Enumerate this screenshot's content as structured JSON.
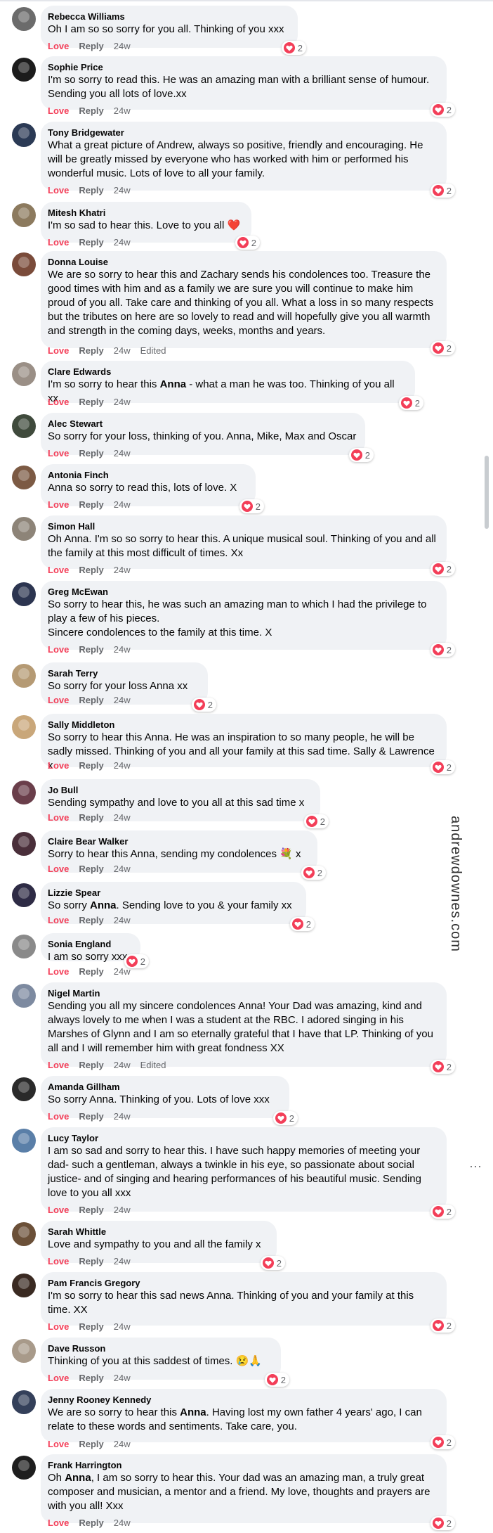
{
  "watermark": "andrewdownes.com",
  "more_menu": "···",
  "comments": [
    {
      "author": "Rebecca Williams",
      "text": "Oh I am so so sorry for you all. Thinking of you xxx",
      "love": "Love",
      "reply": "Reply",
      "time": "24w",
      "edited": "",
      "count": "2",
      "avatar_color": "#6b6b6b"
    },
    {
      "author": "Sophie Price",
      "text": "I'm so sorry to read this. He was an amazing man with a brilliant sense of humour. Sending you all lots of love.xx",
      "love": "Love",
      "reply": "Reply",
      "time": "24w",
      "edited": "",
      "count": "2",
      "avatar_color": "#1c1c1c"
    },
    {
      "author": "Tony Bridgewater",
      "text": "What a great picture of Andrew, always so positive, friendly and encouraging. He will be greatly missed by everyone who has worked with him or performed his wonderful music. Lots of love to all your family.",
      "love": "Love",
      "reply": "Reply",
      "time": "24w",
      "edited": "",
      "count": "2",
      "avatar_color": "#2b3a55"
    },
    {
      "author": "Mitesh Khatri",
      "text": "I'm so sad to hear this. Love to you all ❤️",
      "love": "Love",
      "reply": "Reply",
      "time": "24w",
      "edited": "",
      "count": "2",
      "avatar_color": "#8c7a5e"
    },
    {
      "author": "Donna Louise",
      "text": "We are so sorry to hear this and Zachary sends his condolences too. Treasure the good times with him and as a family we are sure you will continue to make him proud of you all. Take care and thinking of you all. What a loss in so many respects but the tributes on here are so lovely to read and will hopefully give you all warmth and strength in the coming days, weeks, months and years.",
      "love": "Love",
      "reply": "Reply",
      "time": "24w",
      "edited": "Edited",
      "count": "2",
      "avatar_color": "#7a4b3a"
    },
    {
      "author": "Clare Edwards",
      "text_pre": "I'm so sorry to hear this ",
      "text_bold": "Anna",
      "text_post": " - what a man he was too. Thinking of you all xx",
      "love": "Love",
      "reply": "Reply",
      "time": "24w",
      "edited": "",
      "count": "2",
      "avatar_color": "#9a8f86"
    },
    {
      "author": "Alec Stewart",
      "text": "So sorry for your loss, thinking of you. Anna, Mike, Max and Oscar",
      "love": "Love",
      "reply": "Reply",
      "time": "24w",
      "edited": "",
      "count": "2",
      "avatar_color": "#3f4a3c"
    },
    {
      "author": "Antonia Finch",
      "text": "Anna so sorry to read this, lots of love. X",
      "love": "Love",
      "reply": "Reply",
      "time": "24w",
      "edited": "",
      "count": "2",
      "avatar_color": "#7c5a44"
    },
    {
      "author": "Simon Hall",
      "text": "Oh Anna. I'm so so sorry to hear this. A unique musical soul. Thinking of you and all the family at this most difficult of times. Xx",
      "love": "Love",
      "reply": "Reply",
      "time": "24w",
      "edited": "",
      "count": "2",
      "avatar_color": "#8d8478"
    },
    {
      "author": "Greg McEwan",
      "text": "So sorry to hear this, he was such an amazing man to which I had the privilege to play a few of his pieces.\nSincere condolences to the family at this time. X",
      "love": "Love",
      "reply": "Reply",
      "time": "24w",
      "edited": "",
      "count": "2",
      "avatar_color": "#2c3550"
    },
    {
      "author": "Sarah Terry",
      "text": "So sorry for your loss Anna xx",
      "love": "Love",
      "reply": "Reply",
      "time": "24w",
      "edited": "",
      "count": "2",
      "avatar_color": "#b59a74"
    },
    {
      "author": "Sally Middleton",
      "text": "So sorry to hear this Anna. He was an inspiration to so many people, he will be sadly missed. Thinking of you and all your family at this sad time. Sally & Lawrence x",
      "love": "Love",
      "reply": "Reply",
      "time": "24w",
      "edited": "",
      "count": "2",
      "avatar_color": "#c9a77a"
    },
    {
      "author": "Jo Bull",
      "text": "Sending sympathy and love to you all at this sad time x",
      "love": "Love",
      "reply": "Reply",
      "time": "24w",
      "edited": "",
      "count": "2",
      "avatar_color": "#6a3e4a"
    },
    {
      "author": "Claire Bear Walker",
      "text": "Sorry to hear this Anna, sending my condolences 💐 x",
      "love": "Love",
      "reply": "Reply",
      "time": "24w",
      "edited": "",
      "count": "2",
      "avatar_color": "#4a2f3a"
    },
    {
      "author": "Lizzie Spear",
      "text_pre": "So sorry ",
      "text_bold": "Anna",
      "text_post": ". Sending love to you & your family xx",
      "love": "Love",
      "reply": "Reply",
      "time": "24w",
      "edited": "",
      "count": "2",
      "avatar_color": "#2e2b45"
    },
    {
      "author": "Sonia England",
      "text": "I am so sorry xxx",
      "love": "Love",
      "reply": "Reply",
      "time": "24w",
      "edited": "",
      "count": "2",
      "avatar_color": "#8a8a8a"
    },
    {
      "author": "Nigel Martin",
      "text": "Sending you all my sincere condolences Anna! Your Dad was amazing, kind and always lovely to me when I was a student at the RBC. I adored singing in his Marshes of Glynn and I am so eternally grateful that I have that LP. Thinking of you all and I will remember him with great fondness XX",
      "love": "Love",
      "reply": "Reply",
      "time": "24w",
      "edited": "Edited",
      "count": "2",
      "avatar_color": "#7d8aa0"
    },
    {
      "author": "Amanda Gillham",
      "text": "So sorry Anna. Thinking of you. Lots of love xxx",
      "love": "Love",
      "reply": "Reply",
      "time": "24w",
      "edited": "",
      "count": "2",
      "avatar_color": "#2a2a2a"
    },
    {
      "author": "Lucy Taylor",
      "text": "I am so sad and sorry to hear this. I have such happy memories of meeting your dad- such a gentleman, always a twinkle in his eye, so passionate about social justice- and of singing and hearing performances of his beautiful music. Sending love to you all xxx",
      "love": "Love",
      "reply": "Reply",
      "time": "24w",
      "edited": "",
      "count": "2",
      "avatar_color": "#5a7fa8"
    },
    {
      "author": "Sarah Whittle",
      "text": "Love and sympathy to you and all the family x",
      "love": "Love",
      "reply": "Reply",
      "time": "24w",
      "edited": "",
      "count": "2",
      "avatar_color": "#6b5038"
    },
    {
      "author": "Pam Francis Gregory",
      "text": "I'm so sorry to hear this sad news Anna. Thinking of you and your family at this time. XX",
      "love": "Love",
      "reply": "Reply",
      "time": "24w",
      "edited": "",
      "count": "2",
      "avatar_color": "#3a2a22"
    },
    {
      "author": "Dave Russon",
      "text": "Thinking of you at this saddest of times. 😢🙏",
      "love": "Love",
      "reply": "Reply",
      "time": "24w",
      "edited": "",
      "count": "2",
      "avatar_color": "#a89a8a"
    },
    {
      "author": "Jenny Rooney Kennedy",
      "text_pre": "We are so sorry to hear this ",
      "text_bold": "Anna",
      "text_post": ". Having lost my own father 4 years' ago, I can relate to these words and sentiments. Take care, you.",
      "love": "Love",
      "reply": "Reply",
      "time": "24w",
      "edited": "",
      "count": "2",
      "avatar_color": "#34405a"
    },
    {
      "author": "Frank Harrington",
      "text_pre": "Oh ",
      "text_bold": "Anna",
      "text_post": ", I am so sorry to hear this. Your dad was an amazing man, a truly great composer and musician, a mentor and a friend. My love, thoughts and prayers are with you all! Xxx",
      "love": "Love",
      "reply": "Reply",
      "time": "24w",
      "edited": "",
      "count": "2",
      "avatar_color": "#1e1e1e"
    }
  ]
}
